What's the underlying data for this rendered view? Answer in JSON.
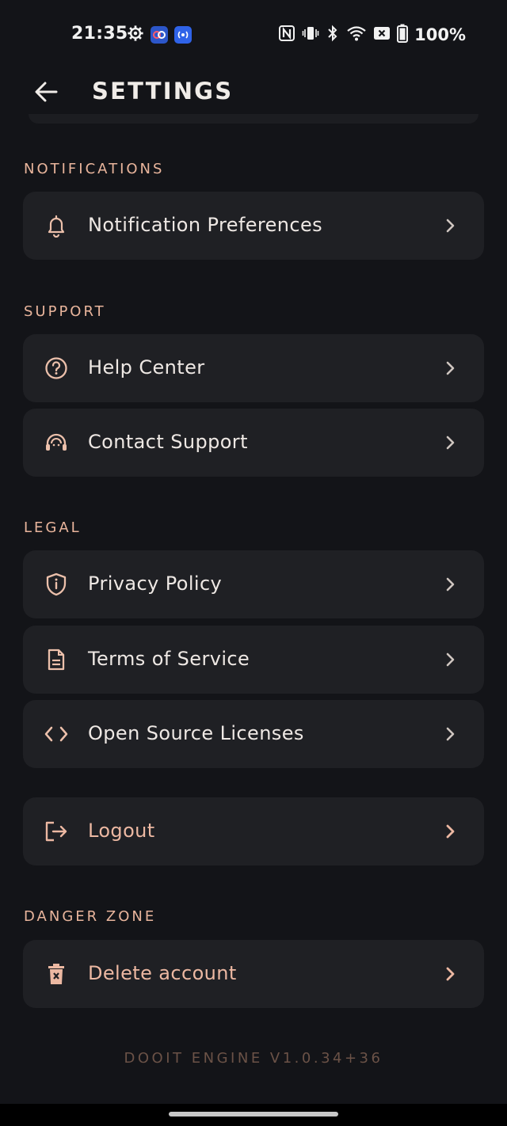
{
  "status_bar": {
    "time": "21:35",
    "battery_text": "100%"
  },
  "header": {
    "title": "SETTINGS"
  },
  "sections": {
    "notifications": {
      "heading": "NOTIFICATIONS",
      "notification_preferences": "Notification Preferences"
    },
    "support": {
      "heading": "SUPPORT",
      "help_center": "Help Center",
      "contact_support": "Contact Support"
    },
    "legal": {
      "heading": "LEGAL",
      "privacy_policy": "Privacy Policy",
      "terms_of_service": "Terms of Service",
      "open_source_licenses": "Open Source Licenses"
    },
    "account": {
      "logout": "Logout"
    },
    "danger_zone": {
      "heading": "DANGER ZONE",
      "delete_account": "Delete account"
    }
  },
  "footer": {
    "version": "DOOIT ENGINE V1.0.34+36"
  },
  "colors": {
    "background": "#131418",
    "card": "#1f2024",
    "accent": "#e9b59c",
    "text": "#eee8e4"
  },
  "icons": {
    "notification_preferences": "bell-icon",
    "help_center": "help-circle-icon",
    "contact_support": "headset-icon",
    "privacy_policy": "shield-info-icon",
    "terms_of_service": "document-icon",
    "open_source_licenses": "code-icon",
    "logout": "logout-icon",
    "delete_account": "trash-icon"
  }
}
